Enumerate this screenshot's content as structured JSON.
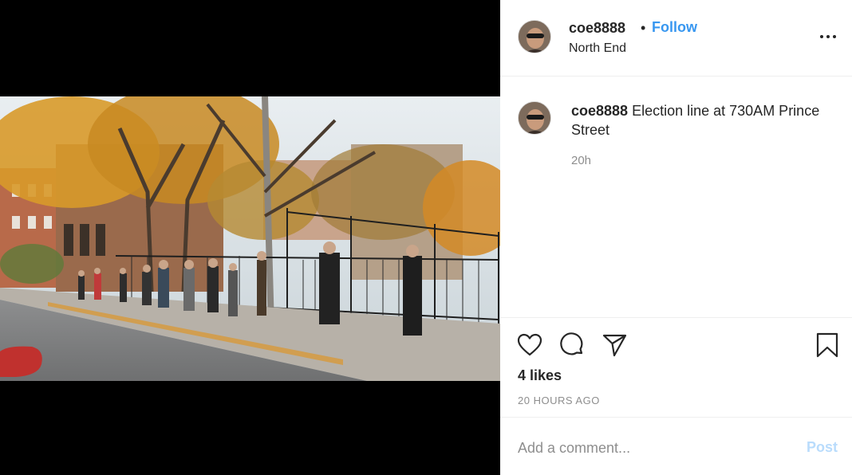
{
  "post": {
    "username": "coe8888",
    "separator": "•",
    "follow_label": "Follow",
    "location": "North End",
    "more_icon": "more-options-icon",
    "photo_icon": "photo-of-election-line"
  },
  "caption": {
    "username": "coe8888",
    "text": "Election line at 730AM Prince Street",
    "time": "20h"
  },
  "actions": {
    "icons": [
      "heart-icon",
      "comment-icon",
      "share-icon",
      "bookmark-icon"
    ],
    "likes": "4 likes",
    "time_ago": "20 HOURS AGO"
  },
  "comment": {
    "placeholder": "Add a comment...",
    "post_label": "Post"
  },
  "colors": {
    "follow": "#3897f0",
    "post_disabled": "#b9dcfc",
    "secondary_text": "#8e8e8e",
    "divider": "#efefef"
  }
}
